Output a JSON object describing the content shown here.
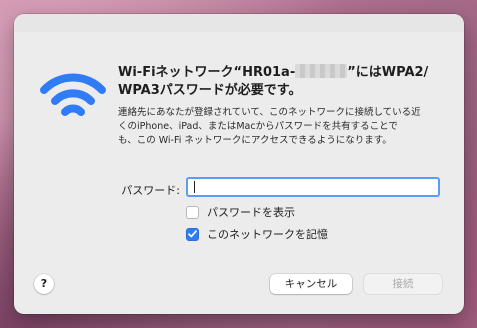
{
  "dialog": {
    "title_part1": "Wi-Fiネットワーク“HR01a-",
    "title_part2": "”にはWPA2/",
    "title_line2": "WPA3パスワードが必要です。",
    "description_line1": "連絡先にあなたが登録されていて、このネットワークに接続している近",
    "description_line2": "くのiPhone、iPad、またはMacからパスワードを共有することで",
    "description_line3": "も、この Wi-Fi ネットワークにアクセスできるようになります。",
    "password_label": "パスワード:",
    "password_value": "",
    "show_password_label": "パスワードを表示",
    "show_password_checked": false,
    "remember_network_label": "このネットワークを記憶",
    "remember_network_checked": true,
    "help_label": "?",
    "cancel_label": "キャンセル",
    "connect_label": "接続",
    "connect_enabled": false
  },
  "icons": {
    "wifi": "wifi-icon",
    "checkmark": "checkmark-icon"
  },
  "colors": {
    "wifi_blue": "#2f7cf6",
    "accent": "#2f7cf6",
    "focus_ring": "#5a9cf7",
    "dialog_bg": "#ececec"
  }
}
